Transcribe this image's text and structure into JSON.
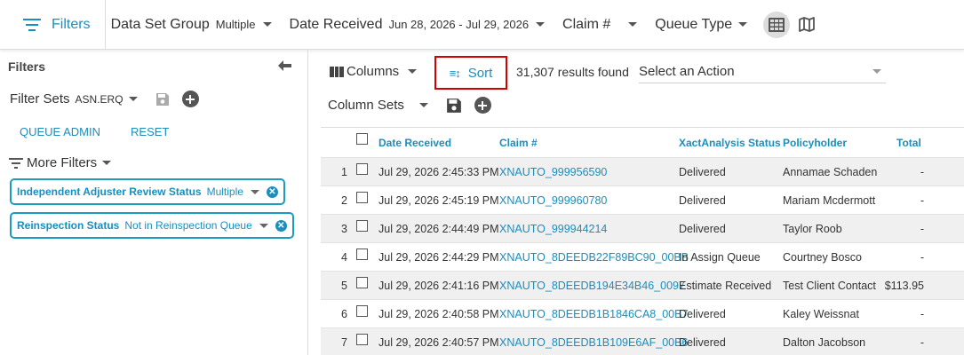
{
  "topbar": {
    "filters_label": "Filters",
    "items": [
      {
        "label": "Data Set Group",
        "value": "Multiple"
      },
      {
        "label": "Date Received",
        "value": "Jun 28, 2026 - Jul 29, 2026"
      },
      {
        "label": "Claim #",
        "value": ""
      },
      {
        "label": "Queue Type",
        "value": ""
      }
    ]
  },
  "left": {
    "title": "Filters",
    "filter_sets_label": "Filter Sets",
    "filter_sets_value": "ASN.ERQ",
    "queue_admin": "QUEUE ADMIN",
    "reset": "RESET",
    "more_filters": "More Filters",
    "chips": [
      {
        "key": "Independent Adjuster Review Status",
        "value": "Multiple"
      },
      {
        "key": "Reinspection Status",
        "value": "Not in Reinspection Queue"
      }
    ]
  },
  "main": {
    "columns_label": "Columns",
    "sort_label": "Sort",
    "results": "31,307 results found",
    "action_placeholder": "Select an Action",
    "column_sets_label": "Column Sets",
    "headers": [
      "Date Received",
      "Claim #",
      "XactAnalysis Status",
      "Policyholder",
      "Total"
    ],
    "rows": [
      {
        "num": "1",
        "date": "Jul 29, 2026 2:45:33 PM",
        "claim": "XNAUTO_999956590",
        "status": "Delivered",
        "holder": "Annamae Schaden",
        "total": "-"
      },
      {
        "num": "2",
        "date": "Jul 29, 2026 2:45:19 PM",
        "claim": "XNAUTO_999960780",
        "status": "Delivered",
        "holder": "Mariam Mcdermott",
        "total": "-"
      },
      {
        "num": "3",
        "date": "Jul 29, 2026 2:44:49 PM",
        "claim": "XNAUTO_999944214",
        "status": "Delivered",
        "holder": "Taylor Roob",
        "total": "-"
      },
      {
        "num": "4",
        "date": "Jul 29, 2026 2:44:29 PM",
        "claim": "XNAUTO_8DEEDB22F89BC90_00BB",
        "status": "In Assign Queue",
        "holder": "Courtney Bosco",
        "total": "-"
      },
      {
        "num": "5",
        "date": "Jul 29, 2026 2:41:16 PM",
        "claim": "XNAUTO_8DEEDB194E34B46_0097",
        "status": "Estimate Received",
        "holder": "Test Client Contact",
        "total": "$113.95"
      },
      {
        "num": "6",
        "date": "Jul 29, 2026 2:40:58 PM",
        "claim": "XNAUTO_8DEEDB1B1846CA8_00B7",
        "status": "Delivered",
        "holder": "Kaley Weissnat",
        "total": "-"
      },
      {
        "num": "7",
        "date": "Jul 29, 2026 2:40:57 PM",
        "claim": "XNAUTO_8DEEDB1B109E6AF_00B6",
        "status": "Delivered",
        "holder": "Dalton Jacobson",
        "total": "-"
      }
    ]
  },
  "colors": {
    "accent": "#1a8ebd",
    "highlight": "#d40000"
  }
}
